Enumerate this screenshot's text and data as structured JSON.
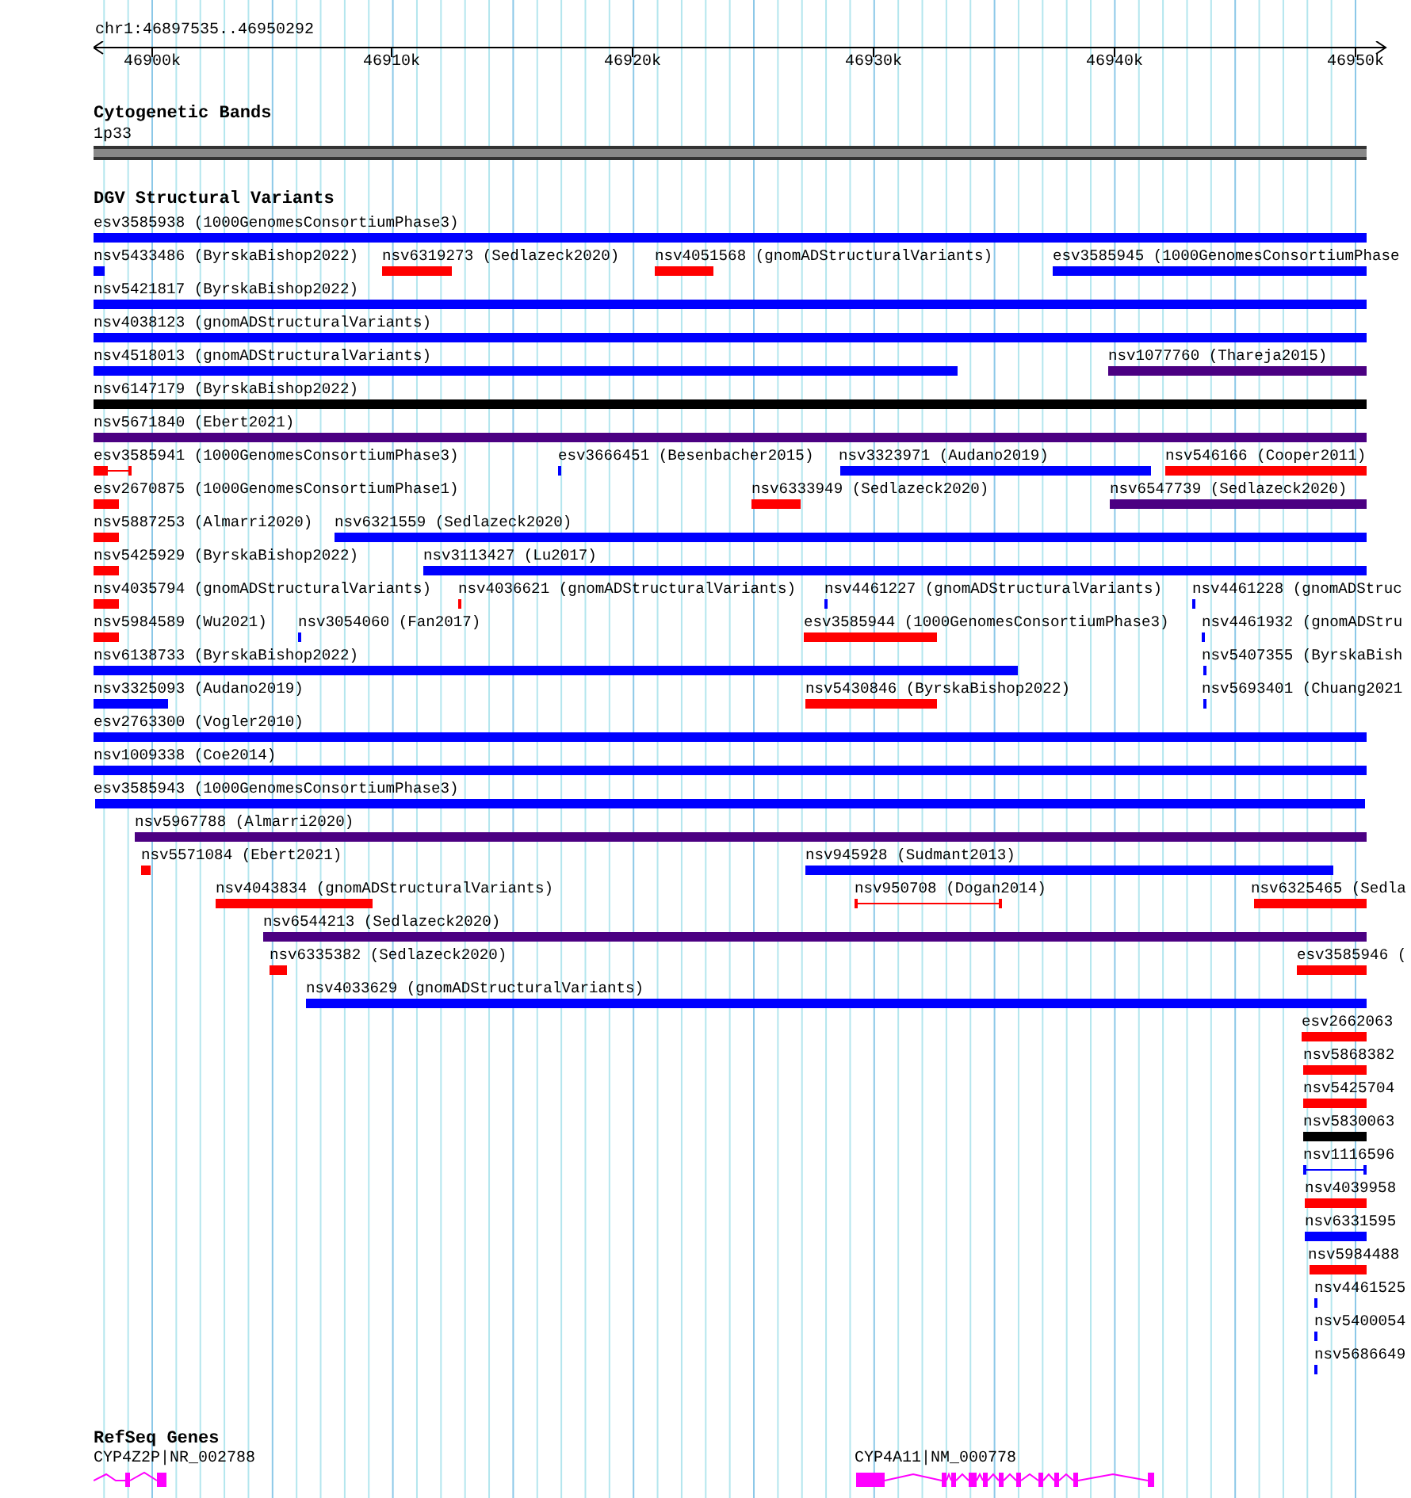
{
  "ruler": {
    "location": "chr1:46897535..46950292",
    "ticks": [
      "46900k",
      "46910k",
      "46920k",
      "46930k",
      "46940k",
      "46950k"
    ]
  },
  "cytogenetic_bands": {
    "title": "Cytogenetic Bands",
    "band": {
      "label": "1p33"
    }
  },
  "dgv_structural_variants": {
    "title": "DGV Structural Variants",
    "rows": [
      [
        {
          "label": "esv3585938 (1000GenomesConsortiumPhase3)",
          "color": "#0000ff",
          "kind": "bar"
        }
      ],
      [
        {
          "label": "nsv5433486 (ByrskaBishop2022)",
          "color": "#0000ff",
          "kind": "bar"
        },
        {
          "label": "nsv6319273 (Sedlazeck2020)",
          "color": "#ff0000",
          "kind": "bar"
        },
        {
          "label": "nsv4051568 (gnomADStructuralVariants)",
          "color": "#ff0000",
          "kind": "bar"
        },
        {
          "label": "esv3585945 (1000GenomesConsortiumPhase",
          "color": "#0000ff",
          "kind": "bar"
        }
      ],
      [
        {
          "label": "nsv5421817 (ByrskaBishop2022)",
          "color": "#0000ff",
          "kind": "bar"
        }
      ],
      [
        {
          "label": "nsv4038123 (gnomADStructuralVariants)",
          "color": "#0000ff",
          "kind": "bar"
        }
      ],
      [
        {
          "label": "nsv4518013 (gnomADStructuralVariants)",
          "color": "#0000ff",
          "kind": "bar"
        },
        {
          "label": "nsv1077760 (Thareja2015)",
          "color": "#4b0082",
          "kind": "bar"
        }
      ],
      [
        {
          "label": "nsv6147179 (ByrskaBishop2022)",
          "color": "#000000",
          "kind": "bar"
        }
      ],
      [
        {
          "label": "nsv5671840 (Ebert2021)",
          "color": "#4b0082",
          "kind": "bar"
        }
      ],
      [
        {
          "label": "esv3585941 (1000GenomesConsortiumPhase3)",
          "color": "#ff0000",
          "kind": "bar_span"
        },
        {
          "label": "esv3666451 (Besenbacher2015)",
          "color": "#0000ff",
          "kind": "bar"
        },
        {
          "label": "nsv3323971 (Audano2019)",
          "color": "#0000ff",
          "kind": "bar"
        },
        {
          "label": "nsv546166 (Cooper2011)",
          "color": "#ff0000",
          "kind": "bar"
        }
      ],
      [
        {
          "label": "esv2670875 (1000GenomesConsortiumPhase1)",
          "color": "#ff0000",
          "kind": "bar"
        },
        {
          "label": "nsv6333949 (Sedlazeck2020)",
          "color": "#ff0000",
          "kind": "bar"
        },
        {
          "label": "nsv6547739 (Sedlazeck2020)",
          "color": "#4b0082",
          "kind": "bar"
        }
      ],
      [
        {
          "label": "nsv5887253 (Almarri2020)",
          "color": "#ff0000",
          "kind": "bar"
        },
        {
          "label": "nsv6321559 (Sedlazeck2020)",
          "color": "#0000ff",
          "kind": "bar"
        }
      ],
      [
        {
          "label": "nsv5425929 (ByrskaBishop2022)",
          "color": "#ff0000",
          "kind": "bar"
        },
        {
          "label": "nsv3113427 (Lu2017)",
          "color": "#0000ff",
          "kind": "bar"
        }
      ],
      [
        {
          "label": "nsv4035794 (gnomADStructuralVariants)",
          "color": "#ff0000",
          "kind": "bar"
        },
        {
          "label": "nsv4036621 (gnomADStructuralVariants)",
          "color": "#ff0000",
          "kind": "bar"
        },
        {
          "label": "nsv4461227 (gnomADStructuralVariants)",
          "color": "#0000ff",
          "kind": "bar"
        },
        {
          "label": "nsv4461228 (gnomADStruc",
          "color": "#0000ff",
          "kind": "bar"
        }
      ],
      [
        {
          "label": "nsv5984589 (Wu2021)",
          "color": "#ff0000",
          "kind": "bar"
        },
        {
          "label": "nsv3054060 (Fan2017)",
          "color": "#0000ff",
          "kind": "bar"
        },
        {
          "label": "esv3585944 (1000GenomesConsortiumPhase3)",
          "color": "#ff0000",
          "kind": "bar"
        },
        {
          "label": "nsv4461932 (gnomADStru",
          "color": "#0000ff",
          "kind": "bar"
        }
      ],
      [
        {
          "label": "nsv6138733 (ByrskaBishop2022)",
          "color": "#0000ff",
          "kind": "bar"
        },
        {
          "label": "nsv5407355 (ByrskaBish",
          "color": "#0000ff",
          "kind": "bar"
        }
      ],
      [
        {
          "label": "nsv3325093 (Audano2019)",
          "color": "#0000ff",
          "kind": "bar"
        },
        {
          "label": "nsv5430846 (ByrskaBishop2022)",
          "color": "#ff0000",
          "kind": "bar"
        },
        {
          "label": "nsv5693401 (Chuang2021",
          "color": "#0000ff",
          "kind": "bar"
        }
      ],
      [
        {
          "label": "esv2763300 (Vogler2010)",
          "color": "#0000ff",
          "kind": "bar"
        }
      ],
      [
        {
          "label": "nsv1009338 (Coe2014)",
          "color": "#0000ff",
          "kind": "bar"
        }
      ],
      [
        {
          "label": "esv3585943 (1000GenomesConsortiumPhase3)",
          "color": "#0000ff",
          "kind": "bar"
        }
      ],
      [
        {
          "label": "nsv5967788 (Almarri2020)",
          "color": "#4b0082",
          "kind": "bar"
        }
      ],
      [
        {
          "label": "nsv5571084 (Ebert2021)",
          "color": "#ff0000",
          "kind": "bar"
        },
        {
          "label": "nsv945928 (Sudmant2013)",
          "color": "#0000ff",
          "kind": "bar"
        }
      ],
      [
        {
          "label": "nsv4043834 (gnomADStructuralVariants)",
          "color": "#ff0000",
          "kind": "bar"
        },
        {
          "label": "nsv950708 (Dogan2014)",
          "color": "#ff0000",
          "kind": "span"
        },
        {
          "label": "nsv6325465 (Sedla",
          "color": "#ff0000",
          "kind": "bar"
        }
      ],
      [
        {
          "label": "nsv6544213 (Sedlazeck2020)",
          "color": "#4b0082",
          "kind": "bar"
        }
      ],
      [
        {
          "label": "nsv6335382 (Sedlazeck2020)",
          "color": "#ff0000",
          "kind": "bar"
        },
        {
          "label": "esv3585946 (",
          "color": "#ff0000",
          "kind": "bar"
        }
      ],
      [
        {
          "label": "nsv4033629 (gnomADStructuralVariants)",
          "color": "#0000ff",
          "kind": "bar"
        }
      ],
      [
        {
          "label": "esv2662063",
          "color": "#ff0000",
          "kind": "bar"
        }
      ],
      [
        {
          "label": "nsv5868382",
          "color": "#ff0000",
          "kind": "bar"
        }
      ],
      [
        {
          "label": "nsv5425704",
          "color": "#ff0000",
          "kind": "bar"
        }
      ],
      [
        {
          "label": "nsv5830063",
          "color": "#000000",
          "kind": "bar"
        }
      ],
      [
        {
          "label": "nsv1116596",
          "color": "#0000ff",
          "kind": "span"
        }
      ],
      [
        {
          "label": "nsv4039958",
          "color": "#ff0000",
          "kind": "bar"
        }
      ],
      [
        {
          "label": "nsv6331595",
          "color": "#0000ff",
          "kind": "bar"
        }
      ],
      [
        {
          "label": "nsv5984488",
          "color": "#ff0000",
          "kind": "bar"
        }
      ],
      [
        {
          "label": "nsv4461525",
          "color": "#0000ff",
          "kind": "bar"
        }
      ],
      [
        {
          "label": "nsv5400054",
          "color": "#0000ff",
          "kind": "bar"
        }
      ],
      [
        {
          "label": "nsv5686649",
          "color": "#0000ff",
          "kind": "bar"
        }
      ]
    ]
  },
  "refseq_genes": {
    "title": "RefSeq Genes",
    "genes": [
      {
        "label": "CYP4Z2P|NR_002788"
      },
      {
        "label": "CYP4A11|NM_000778"
      }
    ]
  }
}
